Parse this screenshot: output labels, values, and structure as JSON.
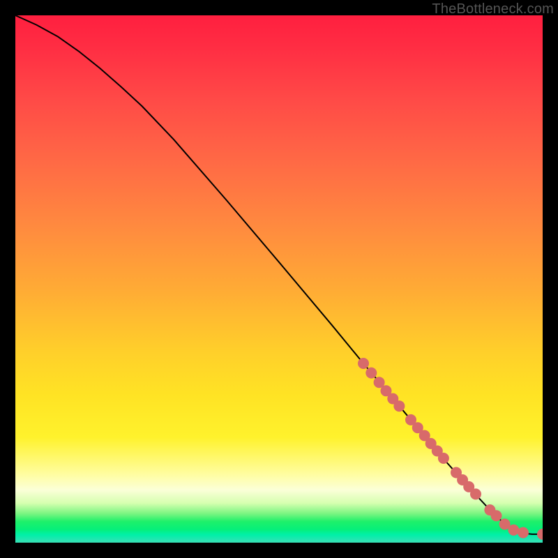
{
  "watermark": "TheBottleneck.com",
  "colors": {
    "marker": "#d86a6a",
    "curve": "#000000"
  },
  "chart_data": {
    "type": "line",
    "title": "",
    "xlabel": "",
    "ylabel": "",
    "xlim": [
      0,
      100
    ],
    "ylim": [
      0,
      100
    ],
    "grid": false,
    "legend": false,
    "series": [
      {
        "name": "curve",
        "kind": "line",
        "x": [
          0,
          4,
          8,
          12,
          16,
          20,
          24,
          30,
          40,
          50,
          60,
          66,
          70,
          74,
          78,
          82,
          86,
          90,
          92,
          94,
          96,
          98,
          100
        ],
        "y": [
          100,
          98.2,
          96.0,
          93.2,
          90.0,
          86.5,
          82.8,
          76.5,
          65.0,
          53.2,
          41.3,
          34.0,
          29.3,
          24.5,
          19.8,
          15.0,
          10.5,
          6.2,
          4.3,
          2.8,
          1.8,
          1.6,
          1.6
        ]
      },
      {
        "name": "markers",
        "kind": "scatter",
        "points": [
          {
            "x": 66.0,
            "y": 34.0
          },
          {
            "x": 67.5,
            "y": 32.2
          },
          {
            "x": 69.0,
            "y": 30.4
          },
          {
            "x": 70.3,
            "y": 28.8
          },
          {
            "x": 71.6,
            "y": 27.3
          },
          {
            "x": 72.8,
            "y": 25.9
          },
          {
            "x": 75.0,
            "y": 23.3
          },
          {
            "x": 76.3,
            "y": 21.8
          },
          {
            "x": 77.6,
            "y": 20.3
          },
          {
            "x": 78.8,
            "y": 18.8
          },
          {
            "x": 80.0,
            "y": 17.4
          },
          {
            "x": 81.2,
            "y": 16.0
          },
          {
            "x": 83.6,
            "y": 13.3
          },
          {
            "x": 84.8,
            "y": 11.9
          },
          {
            "x": 86.0,
            "y": 10.6
          },
          {
            "x": 87.3,
            "y": 9.2
          },
          {
            "x": 90.0,
            "y": 6.2
          },
          {
            "x": 91.2,
            "y": 5.1
          },
          {
            "x": 92.8,
            "y": 3.5
          },
          {
            "x": 94.5,
            "y": 2.4
          },
          {
            "x": 96.3,
            "y": 1.9
          },
          {
            "x": 100.0,
            "y": 1.6
          }
        ]
      }
    ]
  }
}
